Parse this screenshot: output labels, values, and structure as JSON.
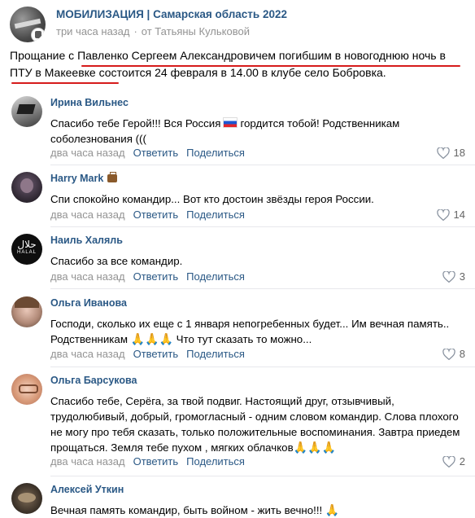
{
  "post": {
    "group_name": "МОБИЛИЗАЦИЯ | Самарская область 2022",
    "time": "три часа назад",
    "author_line": "от Татьяны Кульковой",
    "text_before": "Прощание с ",
    "text_link1": "Павленко Сергеем Александровичем погибшим в новогоднюю ночь в ПТУ",
    "text_mid": " ",
    "text_link2": "в Макеевке",
    "text_after": " состоится 24 февраля в 14.00 в клубе село Бобровка."
  },
  "comment_actions": {
    "reply": "Ответить",
    "share": "Поделиться"
  },
  "comments": [
    {
      "author": "Ирина Вильнес",
      "text_a": "Спасибо тебе Герой!!! Вся Россия",
      "text_b": "гордится тобой! Родственникам соболезнования (((",
      "time": "два часа назад",
      "likes": "18"
    },
    {
      "author": "Harry Mark",
      "text": "Спи спокойно командир... Вот кто достоин звёзды героя России.",
      "time": "два часа назад",
      "likes": "14"
    },
    {
      "author": "Наиль Халяль",
      "text": "Спасибо за все командир.",
      "time": "два часа назад",
      "likes": "3",
      "avatar_text": "حلال",
      "avatar_sub": "HALAL"
    },
    {
      "author": "Ольга Иванова",
      "text_a": "Господи, сколько их еще с 1 января непогребенных будет... Им вечная память.. Родственникам",
      "text_b": "Что тут сказать то можно...",
      "time": "два часа назад",
      "likes": "8"
    },
    {
      "author": "Ольга Барсукова",
      "text": "Спасибо тебе, Серёга, за твой подвиг. Настоящий друг, отзывчивый, трудолюбивый, добрый, громогласный - одним словом командир. Слова плохого не могу про тебя сказать, только положительные воспоминания. Завтра приедем прощаться. Земля тебе пухом , мягких облачков",
      "time": "два часа назад",
      "likes": "2"
    },
    {
      "author": "Алексей Уткин",
      "text": "Вечная память командир, быть войном - жить вечно!!!"
    }
  ],
  "colors": {
    "link": "#2a5885",
    "meta": "#939393",
    "underline": "#d61b1b"
  },
  "icons": {
    "like": "heart-icon",
    "pray": "folded-hands-emoji",
    "flag": "russia-flag-emoji"
  }
}
